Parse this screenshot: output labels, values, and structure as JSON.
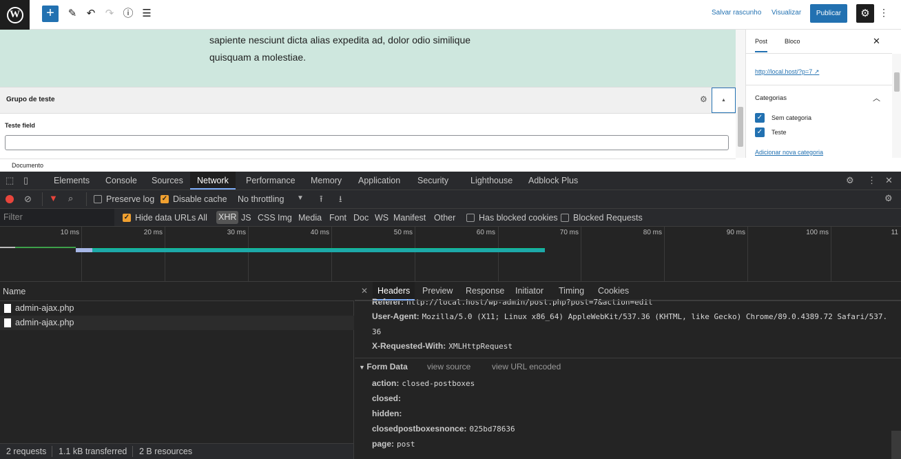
{
  "wp_toolbar": {
    "logo_letter": "W",
    "add_icon": "plus-icon",
    "save_draft": "Salvar rascunho",
    "preview": "Visualizar",
    "publish": "Publicar"
  },
  "editor": {
    "paragraph_lines": [
      "sapiente nesciunt dicta alias expedita ad, dolor odio similique",
      "quisquam a molestiae."
    ],
    "metabox_title": "Grupo de teste",
    "field_label": "Teste field",
    "field_value": "",
    "footer_label": "Documento"
  },
  "sidebar": {
    "tab_post": "Post",
    "tab_block": "Bloco",
    "permalink": "http://local.host/?p=7",
    "categories_title": "Categorias",
    "categories": [
      {
        "label": "Sem categoria",
        "checked": true
      },
      {
        "label": "Teste",
        "checked": true
      }
    ],
    "add_category": "Adicionar nova categoria"
  },
  "devtools": {
    "tabs": [
      "Elements",
      "Console",
      "Sources",
      "Network",
      "Performance",
      "Memory",
      "Application",
      "Security",
      "Lighthouse",
      "Adblock Plus"
    ],
    "active_tab": "Network",
    "toolbar": {
      "preserve_log": "Preserve log",
      "disable_cache": "Disable cache",
      "throttling": "No throttling"
    },
    "filter_bar": {
      "placeholder": "Filter",
      "hide_data_urls": "Hide data URLs",
      "types": [
        "All",
        "XHR",
        "JS",
        "CSS",
        "Img",
        "Media",
        "Font",
        "Doc",
        "WS",
        "Manifest",
        "Other"
      ],
      "active_type": "XHR",
      "has_blocked_cookies": "Has blocked cookies",
      "blocked_requests": "Blocked Requests"
    },
    "timeline_ticks": [
      "10 ms",
      "20 ms",
      "30 ms",
      "40 ms",
      "50 ms",
      "60 ms",
      "70 ms",
      "80 ms",
      "90 ms",
      "100 ms",
      "11"
    ],
    "request_list": {
      "name_header": "Name",
      "requests": [
        "admin-ajax.php",
        "admin-ajax.php"
      ]
    },
    "detail_tabs": [
      "Headers",
      "Preview",
      "Response",
      "Initiator",
      "Timing",
      "Cookies"
    ],
    "active_detail_tab": "Headers",
    "headers": {
      "referer_key": "Referer:",
      "referer_value": "http://local.host/wp-admin/post.php?post=7&action=edit",
      "user_agent_key": "User-Agent:",
      "user_agent_value": "Mozilla/5.0 (X11; Linux x86_64) AppleWebKit/537.36 (KHTML, like Gecko) Chrome/89.0.4389.72 Safari/537.",
      "user_agent_wrap": "36",
      "xrw_key": "X-Requested-With:",
      "xrw_value": "XMLHttpRequest"
    },
    "form_data": {
      "title": "Form Data",
      "view_source": "view source",
      "view_url_encoded": "view URL encoded",
      "fields": [
        {
          "key": "action:",
          "value": "closed-postboxes"
        },
        {
          "key": "closed:",
          "value": ""
        },
        {
          "key": "hidden:",
          "value": ""
        },
        {
          "key": "closedpostboxesnonce:",
          "value": "025bd78636"
        },
        {
          "key": "page:",
          "value": "post"
        }
      ]
    },
    "status": {
      "requests": "2 requests",
      "transferred": "1.1 kB transferred",
      "resources": "2 B resources"
    }
  },
  "colors": {
    "wp_blue": "#2271b1",
    "block_bg": "#cee7de",
    "devtools_bg": "#242424",
    "record_red": "#e8453c"
  }
}
